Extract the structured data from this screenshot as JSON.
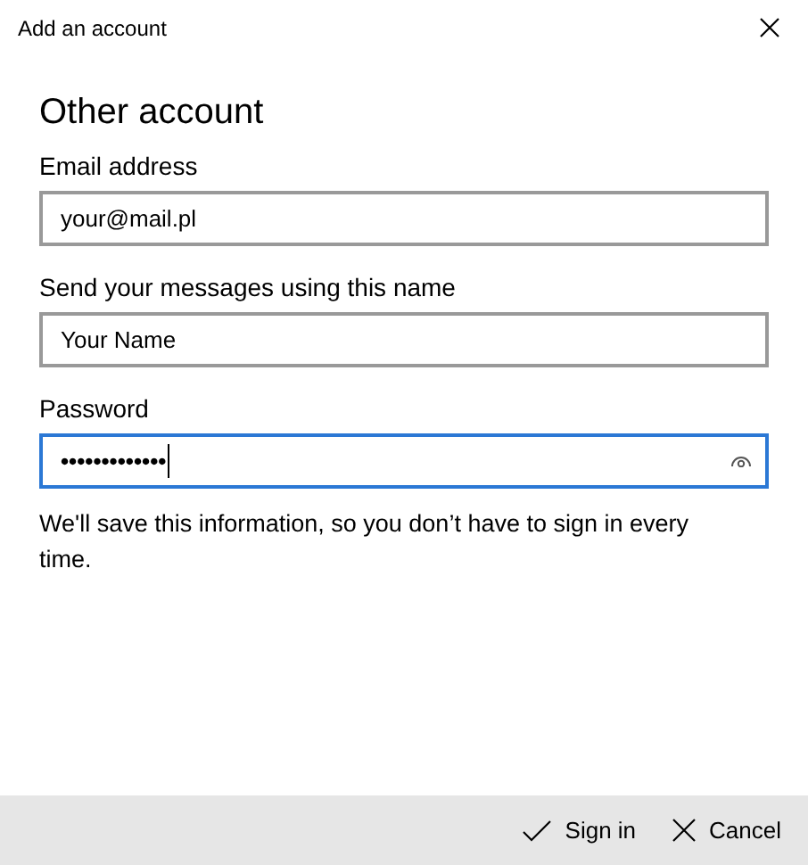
{
  "window": {
    "title": "Add an account"
  },
  "heading": "Other account",
  "fields": [
    {
      "kind": "text",
      "label": "Email address",
      "value": "your@mail.pl",
      "focused": false
    },
    {
      "kind": "text",
      "label": "Send your messages using this name",
      "value": "Your Name",
      "focused": false
    },
    {
      "kind": "password",
      "label": "Password",
      "value": "•••••••••••••",
      "focused": true
    }
  ],
  "note": "We'll save this information, so you don’t have to sign in every time.",
  "buttons": [
    {
      "kind": "confirm",
      "label": "Sign in"
    },
    {
      "kind": "cancel",
      "label": "Cancel"
    }
  ]
}
